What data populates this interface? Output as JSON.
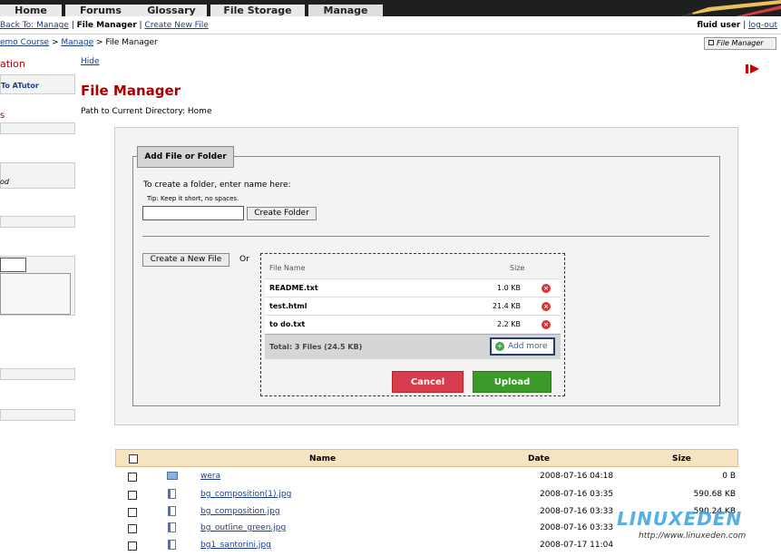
{
  "tabs": [
    {
      "label": "Home",
      "active": false
    },
    {
      "label": "Forums",
      "active": false
    },
    {
      "label": "Glossary",
      "active": false
    },
    {
      "label": "File Storage",
      "active": false
    },
    {
      "label": "Manage",
      "active": true
    }
  ],
  "subnav": {
    "back": "Back To: Manage",
    "sep1": " | ",
    "current": "File Manager",
    "sep2": " | ",
    "create": "Create New File",
    "user": "fluid user",
    "logout": "log-out"
  },
  "crumbs": {
    "course": "emo Course",
    "sep": " > ",
    "manage": "Manage",
    "sep2": " > File Manager"
  },
  "fm_button": "File Manager",
  "sidebar": {
    "title": "ation",
    "link": "To ATutor",
    "red_mark": "s",
    "italic": "od"
  },
  "hide": "Hide",
  "page_title": "File Manager",
  "path": "Path to Current Directory: Home",
  "add_panel": {
    "legend": "Add File or Folder",
    "folder_label": "To create a folder, enter name here:",
    "tip": "Tip: Keep it short, no spaces.",
    "folder_value": "",
    "create_folder": "Create Folder",
    "create_new_file": "Create a New File",
    "or": "Or"
  },
  "uploader": {
    "col_name": "File Name",
    "col_size": "Size",
    "files": [
      {
        "name": "README.txt",
        "size": "1.0 KB"
      },
      {
        "name": "test.html",
        "size": "21.4 KB"
      },
      {
        "name": "to do.txt",
        "size": "2.2 KB"
      }
    ],
    "total": "Total: 3 Files (24.5 KB)",
    "add_more": "Add more",
    "cancel": "Cancel",
    "upload": "Upload"
  },
  "table": {
    "headers": {
      "name": "Name",
      "date": "Date",
      "size": "Size"
    },
    "rows": [
      {
        "name": "wera",
        "date": "2008-07-16 04:18",
        "size": "0 B",
        "type": "folder"
      },
      {
        "name": "bg_composition(1).jpg",
        "date": "2008-07-16 03:35",
        "size": "590.68 KB",
        "type": "image"
      },
      {
        "name": "bg_composition.jpg",
        "date": "2008-07-16 03:33",
        "size": "590.24 KB",
        "type": "image"
      },
      {
        "name": "bg_outline_green.jpg",
        "date": "2008-07-16 03:33",
        "size": "",
        "type": "image"
      },
      {
        "name": "bg1_santorini.jpg",
        "date": "2008-07-17 11:04",
        "size": "",
        "type": "image"
      }
    ]
  },
  "watermark": {
    "line1": "LINUXEDEN",
    "line2": "http://www.linuxeden.com"
  },
  "colors": {
    "accent_red": "#aa0000",
    "link": "#1a3c8c",
    "table_header": "#f6e3bf"
  }
}
